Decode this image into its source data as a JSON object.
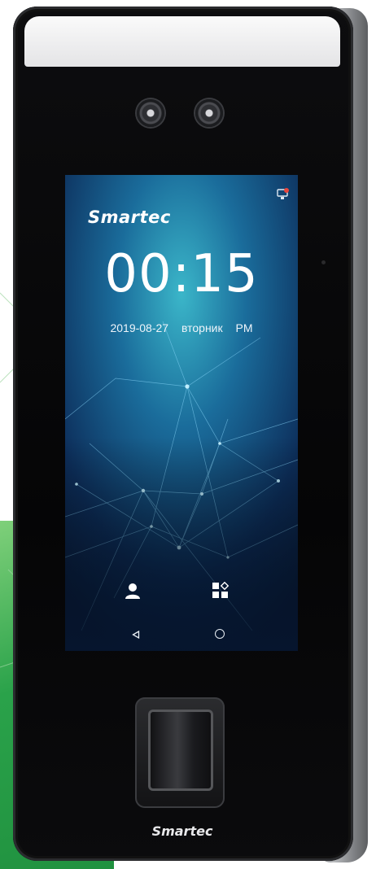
{
  "device": {
    "brand_logo": "Smartec",
    "bottom_logo": "Smartec"
  },
  "screen": {
    "time": "00:15",
    "date": "2019-08-27",
    "weekday": "вторник",
    "meridiem": "PM",
    "icons": {
      "status": "network-status-icon",
      "user": "user-icon",
      "menu": "apps-menu-icon",
      "back": "back-triangle-icon",
      "home": "home-circle-icon"
    }
  },
  "colors": {
    "screen_bg": "#0c2a48",
    "accent": "#2ee0ff",
    "status_red": "#e8453c",
    "green_bg": "#2aa24a"
  }
}
